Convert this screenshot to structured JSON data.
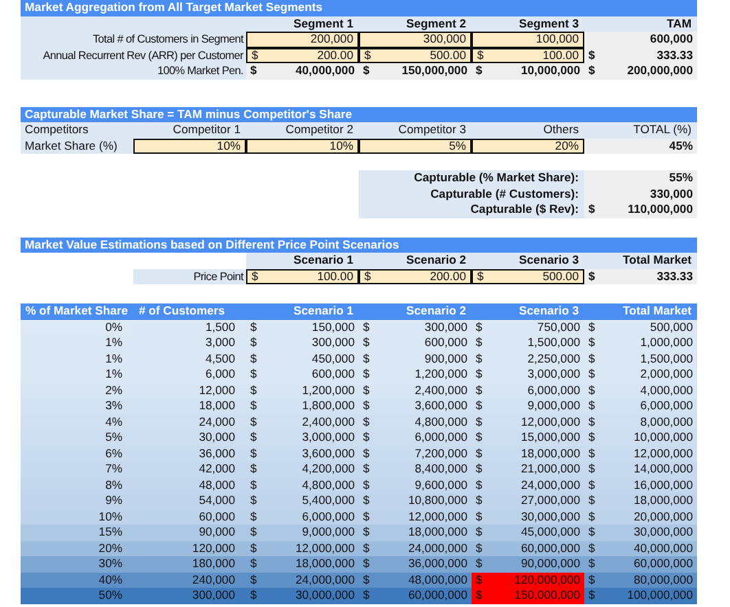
{
  "aggregation": {
    "title": "Market Aggregation from All Target Market Segments",
    "columns": [
      "Segment 1",
      "Segment 2",
      "Segment 3",
      "TAM"
    ],
    "rows": [
      {
        "label": "Total # of Customers in Segment",
        "cells": [
          {
            "value": "200,000",
            "input": true
          },
          {
            "value": "300,000",
            "input": true
          },
          {
            "value": "100,000",
            "input": true
          },
          {
            "value": "600,000",
            "input": false
          }
        ]
      },
      {
        "label": "Annual Recurrent Rev (ARR) per Customer",
        "cells": [
          {
            "currency": "$",
            "value": "200.00",
            "input": true
          },
          {
            "currency": "$",
            "value": "500.00",
            "input": true
          },
          {
            "currency": "$",
            "value": "100.00",
            "input": true
          },
          {
            "currency": "$",
            "value": "333.33",
            "input": false
          }
        ]
      },
      {
        "label": "100% Market Pen.",
        "cells": [
          {
            "currency": "$",
            "value": "40,000,000",
            "input": false
          },
          {
            "currency": "$",
            "value": "150,000,000",
            "input": false
          },
          {
            "currency": "$",
            "value": "10,000,000",
            "input": false
          },
          {
            "currency": "$",
            "value": "200,000,000",
            "input": false
          }
        ]
      }
    ]
  },
  "capturable": {
    "title": "Capturable Market Share = TAM minus Competitor's Share",
    "header_label": "Competitors",
    "columns": [
      "Competitor 1",
      "Competitor 2",
      "Competitor 3",
      "Others",
      "TOTAL (%)"
    ],
    "row_label": "Market Share (%)",
    "cells": [
      {
        "value": "10%",
        "input": true
      },
      {
        "value": "10%",
        "input": true
      },
      {
        "value": "5%",
        "input": true
      },
      {
        "value": "20%",
        "input": true
      },
      {
        "value": "45%",
        "input": false
      }
    ],
    "summary": [
      {
        "label": "Capturable (% Market Share):",
        "value": "55%"
      },
      {
        "label": "Capturable (# Customers):",
        "value": "330,000"
      },
      {
        "label": "Capturable ($ Rev):",
        "currency": "$",
        "value": "110,000,000"
      }
    ]
  },
  "scenarios": {
    "title": "Market Value Estimations based on Different Price Point Scenarios",
    "columns": [
      "Scenario 1",
      "Scenario 2",
      "Scenario 3",
      "Total Market"
    ],
    "row_label": "Price Point",
    "cells": [
      {
        "currency": "$",
        "value": "100.00",
        "input": true
      },
      {
        "currency": "$",
        "value": "200.00",
        "input": true
      },
      {
        "currency": "$",
        "value": "500.00",
        "input": true
      },
      {
        "currency": "$",
        "value": "333.33",
        "input": false
      }
    ]
  },
  "table": {
    "columns": [
      "% of Market Share",
      "# of Customers",
      "Scenario 1",
      "Scenario 2",
      "Scenario 3",
      "Total Market"
    ],
    "rows": [
      {
        "cells": [
          {
            "value": "0%"
          },
          {
            "value": "1,500"
          },
          {
            "currency": "$",
            "value": "150,000",
            "highlight": false
          },
          {
            "currency": "$",
            "value": "300,000",
            "highlight": false
          },
          {
            "currency": "$",
            "value": "750,000",
            "highlight": false
          },
          {
            "currency": "$",
            "value": "500,000",
            "highlight": false
          }
        ]
      },
      {
        "cells": [
          {
            "value": "1%"
          },
          {
            "value": "3,000"
          },
          {
            "currency": "$",
            "value": "300,000",
            "highlight": false
          },
          {
            "currency": "$",
            "value": "600,000",
            "highlight": false
          },
          {
            "currency": "$",
            "value": "1,500,000",
            "highlight": false
          },
          {
            "currency": "$",
            "value": "1,000,000",
            "highlight": false
          }
        ]
      },
      {
        "cells": [
          {
            "value": "1%"
          },
          {
            "value": "4,500"
          },
          {
            "currency": "$",
            "value": "450,000",
            "highlight": false
          },
          {
            "currency": "$",
            "value": "900,000",
            "highlight": false
          },
          {
            "currency": "$",
            "value": "2,250,000",
            "highlight": false
          },
          {
            "currency": "$",
            "value": "1,500,000",
            "highlight": false
          }
        ]
      },
      {
        "cells": [
          {
            "value": "1%"
          },
          {
            "value": "6,000"
          },
          {
            "currency": "$",
            "value": "600,000",
            "highlight": false
          },
          {
            "currency": "$",
            "value": "1,200,000",
            "highlight": false
          },
          {
            "currency": "$",
            "value": "3,000,000",
            "highlight": false
          },
          {
            "currency": "$",
            "value": "2,000,000",
            "highlight": false
          }
        ]
      },
      {
        "cells": [
          {
            "value": "2%"
          },
          {
            "value": "12,000"
          },
          {
            "currency": "$",
            "value": "1,200,000",
            "highlight": false
          },
          {
            "currency": "$",
            "value": "2,400,000",
            "highlight": false
          },
          {
            "currency": "$",
            "value": "6,000,000",
            "highlight": false
          },
          {
            "currency": "$",
            "value": "4,000,000",
            "highlight": false
          }
        ]
      },
      {
        "cells": [
          {
            "value": "3%"
          },
          {
            "value": "18,000"
          },
          {
            "currency": "$",
            "value": "1,800,000",
            "highlight": false
          },
          {
            "currency": "$",
            "value": "3,600,000",
            "highlight": false
          },
          {
            "currency": "$",
            "value": "9,000,000",
            "highlight": false
          },
          {
            "currency": "$",
            "value": "6,000,000",
            "highlight": false
          }
        ]
      },
      {
        "cells": [
          {
            "value": "4%"
          },
          {
            "value": "24,000"
          },
          {
            "currency": "$",
            "value": "2,400,000",
            "highlight": false
          },
          {
            "currency": "$",
            "value": "4,800,000",
            "highlight": false
          },
          {
            "currency": "$",
            "value": "12,000,000",
            "highlight": false
          },
          {
            "currency": "$",
            "value": "8,000,000",
            "highlight": false
          }
        ]
      },
      {
        "cells": [
          {
            "value": "5%"
          },
          {
            "value": "30,000"
          },
          {
            "currency": "$",
            "value": "3,000,000",
            "highlight": false
          },
          {
            "currency": "$",
            "value": "6,000,000",
            "highlight": false
          },
          {
            "currency": "$",
            "value": "15,000,000",
            "highlight": false
          },
          {
            "currency": "$",
            "value": "10,000,000",
            "highlight": false
          }
        ]
      },
      {
        "cells": [
          {
            "value": "6%"
          },
          {
            "value": "36,000"
          },
          {
            "currency": "$",
            "value": "3,600,000",
            "highlight": false
          },
          {
            "currency": "$",
            "value": "7,200,000",
            "highlight": false
          },
          {
            "currency": "$",
            "value": "18,000,000",
            "highlight": false
          },
          {
            "currency": "$",
            "value": "12,000,000",
            "highlight": false
          }
        ]
      },
      {
        "cells": [
          {
            "value": "7%"
          },
          {
            "value": "42,000"
          },
          {
            "currency": "$",
            "value": "4,200,000",
            "highlight": false
          },
          {
            "currency": "$",
            "value": "8,400,000",
            "highlight": false
          },
          {
            "currency": "$",
            "value": "21,000,000",
            "highlight": false
          },
          {
            "currency": "$",
            "value": "14,000,000",
            "highlight": false
          }
        ]
      },
      {
        "cells": [
          {
            "value": "8%"
          },
          {
            "value": "48,000"
          },
          {
            "currency": "$",
            "value": "4,800,000",
            "highlight": false
          },
          {
            "currency": "$",
            "value": "9,600,000",
            "highlight": false
          },
          {
            "currency": "$",
            "value": "24,000,000",
            "highlight": false
          },
          {
            "currency": "$",
            "value": "16,000,000",
            "highlight": false
          }
        ]
      },
      {
        "cells": [
          {
            "value": "9%"
          },
          {
            "value": "54,000"
          },
          {
            "currency": "$",
            "value": "5,400,000",
            "highlight": false
          },
          {
            "currency": "$",
            "value": "10,800,000",
            "highlight": false
          },
          {
            "currency": "$",
            "value": "27,000,000",
            "highlight": false
          },
          {
            "currency": "$",
            "value": "18,000,000",
            "highlight": false
          }
        ]
      },
      {
        "cells": [
          {
            "value": "10%"
          },
          {
            "value": "60,000"
          },
          {
            "currency": "$",
            "value": "6,000,000",
            "highlight": false
          },
          {
            "currency": "$",
            "value": "12,000,000",
            "highlight": false
          },
          {
            "currency": "$",
            "value": "30,000,000",
            "highlight": false
          },
          {
            "currency": "$",
            "value": "20,000,000",
            "highlight": false
          }
        ]
      },
      {
        "cells": [
          {
            "value": "15%"
          },
          {
            "value": "90,000"
          },
          {
            "currency": "$",
            "value": "9,000,000",
            "highlight": false
          },
          {
            "currency": "$",
            "value": "18,000,000",
            "highlight": false
          },
          {
            "currency": "$",
            "value": "45,000,000",
            "highlight": false
          },
          {
            "currency": "$",
            "value": "30,000,000",
            "highlight": false
          }
        ]
      },
      {
        "cells": [
          {
            "value": "20%"
          },
          {
            "value": "120,000"
          },
          {
            "currency": "$",
            "value": "12,000,000",
            "highlight": false
          },
          {
            "currency": "$",
            "value": "24,000,000",
            "highlight": false
          },
          {
            "currency": "$",
            "value": "60,000,000",
            "highlight": false
          },
          {
            "currency": "$",
            "value": "40,000,000",
            "highlight": false
          }
        ]
      },
      {
        "cells": [
          {
            "value": "30%"
          },
          {
            "value": "180,000"
          },
          {
            "currency": "$",
            "value": "18,000,000",
            "highlight": false
          },
          {
            "currency": "$",
            "value": "36,000,000",
            "highlight": false
          },
          {
            "currency": "$",
            "value": "90,000,000",
            "highlight": false
          },
          {
            "currency": "$",
            "value": "60,000,000",
            "highlight": false
          }
        ]
      },
      {
        "cells": [
          {
            "value": "40%"
          },
          {
            "value": "240,000"
          },
          {
            "currency": "$",
            "value": "24,000,000",
            "highlight": false
          },
          {
            "currency": "$",
            "value": "48,000,000",
            "highlight": false
          },
          {
            "currency": "$",
            "value": "120,000,000",
            "highlight": true
          },
          {
            "currency": "$",
            "value": "80,000,000",
            "highlight": false
          }
        ]
      },
      {
        "cells": [
          {
            "value": "50%"
          },
          {
            "value": "300,000"
          },
          {
            "currency": "$",
            "value": "30,000,000",
            "highlight": false
          },
          {
            "currency": "$",
            "value": "60,000,000",
            "highlight": false
          },
          {
            "currency": "$",
            "value": "150,000,000",
            "highlight": true
          },
          {
            "currency": "$",
            "value": "100,000,000",
            "highlight": false
          }
        ]
      }
    ]
  }
}
